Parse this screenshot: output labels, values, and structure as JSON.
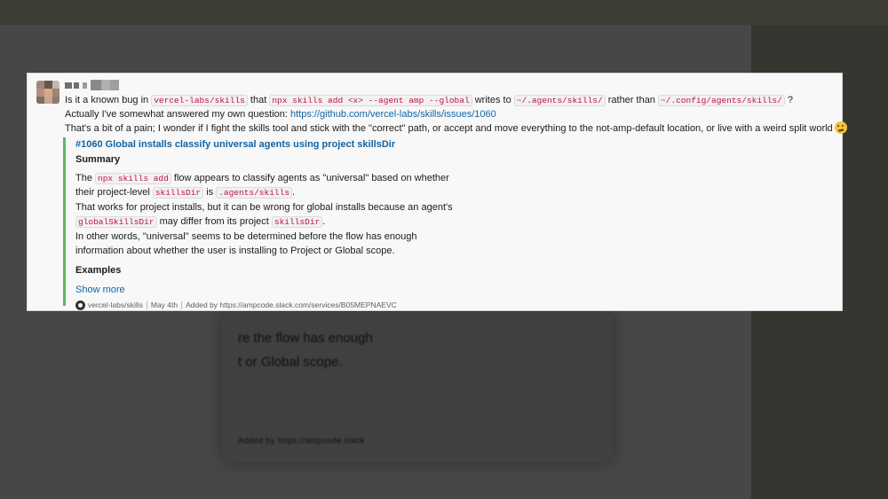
{
  "message": {
    "line1": {
      "t1": "Is it a known bug in ",
      "c1": "vercel-labs/skills",
      "t2": " that ",
      "c2": "npx skills add <x> --agent amp --global",
      "t3": " writes to ",
      "c3": "~/.agents/skills/",
      "t4": " rather than ",
      "c4": "~/.config/agents/skills/",
      "t5": " ?"
    },
    "line2": {
      "text": "Actually I've somewhat answered my own question: ",
      "link": "https://github.com/vercel-labs/skills/issues/1060"
    },
    "line3": "That's a bit of a pain; I wonder if I fight the skills tool and stick with the \"correct\" path, or accept and move everything to the not-amp-default location, or live with a weird split world",
    "emoji": "thinking-face-icon"
  },
  "unfurl": {
    "title": "#1060 Global installs classify universal agents using project skillsDir",
    "summary_heading": "Summary",
    "p1": {
      "t1": "The ",
      "c1": "npx skills add",
      "t2": " flow appears to classify agents as \"universal\" based on whether"
    },
    "p2": {
      "t1": "their project-level ",
      "c1": "skillsDir",
      "t2": " is ",
      "c2": ".agents/skills",
      "t3": "."
    },
    "p3": "That works for project installs, but it can be wrong for global installs because an agent's",
    "p4": {
      "c1": "globalSkillsDir",
      "t1": " may differ from its project ",
      "c2": "skillsDir",
      "t2": "."
    },
    "p5": "In other words, \"universal\" seems to be determined before the flow has enough",
    "p6": "information about whether the user is installing to Project or Global scope.",
    "examples_heading": "Examples",
    "show_more": "Show more",
    "footer": {
      "repo": "vercel-labs/skills",
      "date": "May 4th",
      "added_by": "Added by https://ampcode.slack.com/services/B05MEPNAEVC"
    },
    "accent_color": "#5cb85c"
  },
  "background": {
    "blur1": "re the flow has enough",
    "blur2": "t or Global scope.",
    "blur3": "Added by https://ampcode.slack"
  }
}
